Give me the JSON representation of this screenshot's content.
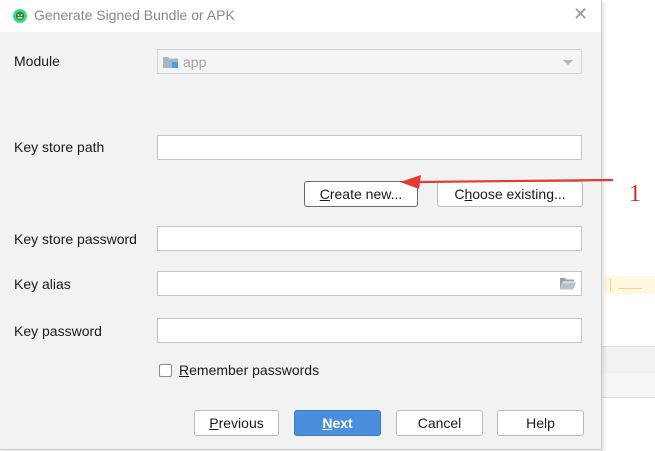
{
  "dialog": {
    "title": "Generate Signed Bundle or APK",
    "close_glyph": "✕"
  },
  "module": {
    "label": "Module",
    "value": "app",
    "icon": "folder-module-icon"
  },
  "key_store_path": {
    "label": "Key store path",
    "value": ""
  },
  "buttons": {
    "create_new_mnemonic": "C",
    "create_new_rest": "reate new...",
    "choose_existing_prefix": "C",
    "choose_existing_mnemonic": "h",
    "choose_existing_rest": "oose existing...",
    "previous_mnemonic": "P",
    "previous_rest": "revious",
    "next_mnemonic": "N",
    "next_rest": "ext",
    "cancel": "Cancel",
    "help": "Help"
  },
  "key_store_password": {
    "label": "Key store password",
    "value": ""
  },
  "key_alias": {
    "label": "Key alias",
    "value": "",
    "icon": "folder-open-icon"
  },
  "key_password": {
    "label": "Key password",
    "value": ""
  },
  "remember": {
    "mnemonic": "R",
    "rest": "emember passwords",
    "checked": false
  },
  "annotation": {
    "number": "1",
    "color": "#e53935"
  },
  "colors": {
    "primary_button": "#4a8fdc",
    "dialog_bg": "#f2f2f2"
  }
}
